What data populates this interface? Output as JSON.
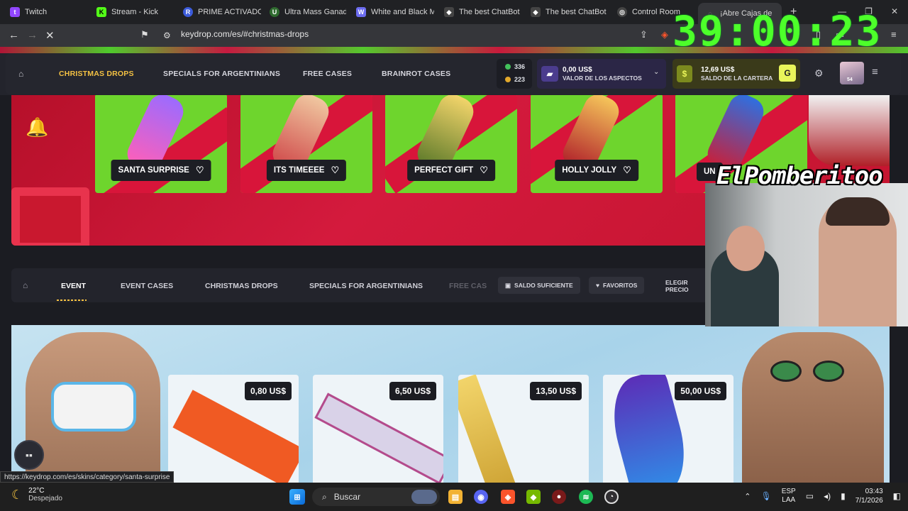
{
  "browser": {
    "tabs": [
      {
        "label": "Twitch",
        "color": "#9146ff",
        "glyph": "t"
      },
      {
        "label": "Stream - Kick",
        "color": "#53fc18",
        "glyph": "K"
      },
      {
        "label": "PRIME ACTIVADO",
        "color": "#3b5bdb",
        "glyph": "R"
      },
      {
        "label": "Ultra Mass Ganad",
        "color": "#2f6b2f",
        "glyph": "U"
      },
      {
        "label": "White and Black M",
        "color": "#6c6cf0",
        "glyph": "W"
      },
      {
        "label": "The best ChatBot",
        "color": "#444",
        "glyph": "◆"
      },
      {
        "label": "The best ChatBot",
        "color": "#444",
        "glyph": "◆"
      },
      {
        "label": "Control Room",
        "color": "#444",
        "glyph": "◎"
      },
      {
        "label": "¡Abre Cajas de",
        "color": "#555",
        "glyph": "◌"
      }
    ],
    "new_tab": "+",
    "url": "keydrop.com/es/#christmas-drops",
    "timer": "39:00:23"
  },
  "header": {
    "nav": [
      "CHRISTMAS DROPS",
      "SPECIALS FOR ARGENTINIANS",
      "FREE CASES",
      "BRAINROT CASES"
    ],
    "coins_green": "336",
    "coins_gold": "223",
    "skins_value": "0,00 US$",
    "skins_label": "VALOR DE LOS ASPECTOS",
    "wallet_value": "12,69 US$",
    "wallet_label": "SALDO DE LA CARTERA",
    "level": "54",
    "colors": {
      "active": "#f4c143",
      "green": "#43c15b",
      "gold": "#e2a82b"
    }
  },
  "banner": {
    "cards": [
      "SANTA SURPRISE",
      "ITS TIMEEEE",
      "PERFECT GIFT",
      "HOLLY JOLLY",
      "UN"
    ]
  },
  "lower_nav": {
    "items": [
      "EVENT",
      "EVENT CASES",
      "CHRISTMAS DROPS",
      "SPECIALS FOR ARGENTINIANS",
      "FREE CAS"
    ],
    "pill_saldo": "SALDO SUFICIENTE",
    "pill_fav": "FAVORITOS",
    "choose_price": "ELEGIR PRECIO"
  },
  "cases": {
    "prices": [
      "0,80 US$",
      "6,50 US$",
      "13,50 US$",
      "50,00 US$"
    ]
  },
  "stream": {
    "cam_name": "ElPomberitoo"
  },
  "status_url": "https://keydrop.com/es/skins/category/santa-surprise",
  "taskbar": {
    "temp": "22°C",
    "weather": "Despejado",
    "search": "Buscar",
    "lang": "ESP",
    "lang2": "LAA",
    "time": "03:43",
    "date": "7/1/2026"
  }
}
